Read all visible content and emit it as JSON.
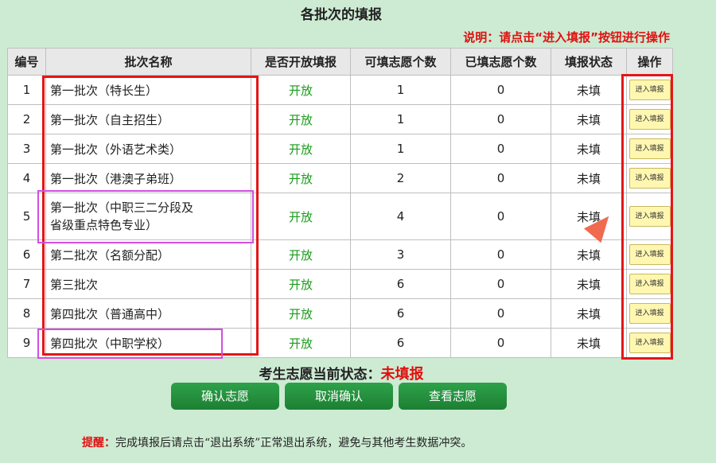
{
  "page": {
    "title": "各批次的填报",
    "note": "说明：请点击“进入填报”按钮进行操作"
  },
  "table": {
    "headers": [
      "编号",
      "批次名称",
      "是否开放填报",
      "可填志愿个数",
      "已填志愿个数",
      "填报状态",
      "操作"
    ],
    "rows": [
      {
        "no": "1",
        "name": "第一批次（特长生）",
        "open": "开放",
        "allowed": "1",
        "filled": "0",
        "status": "未填",
        "action": "进入填报"
      },
      {
        "no": "2",
        "name": "第一批次（自主招生）",
        "open": "开放",
        "allowed": "1",
        "filled": "0",
        "status": "未填",
        "action": "进入填报"
      },
      {
        "no": "3",
        "name": "第一批次（外语艺术类）",
        "open": "开放",
        "allowed": "1",
        "filled": "0",
        "status": "未填",
        "action": "进入填报"
      },
      {
        "no": "4",
        "name": "第一批次（港澳子弟班）",
        "open": "开放",
        "allowed": "2",
        "filled": "0",
        "status": "未填",
        "action": "进入填报"
      },
      {
        "no": "5",
        "name": "第一批次（中职三二分段及省级重点特色专业）",
        "open": "开放",
        "allowed": "4",
        "filled": "0",
        "status": "未填",
        "action": "进入填报"
      },
      {
        "no": "6",
        "name": "第二批次（名额分配）",
        "open": "开放",
        "allowed": "3",
        "filled": "0",
        "status": "未填",
        "action": "进入填报"
      },
      {
        "no": "7",
        "name": "第三批次",
        "open": "开放",
        "allowed": "6",
        "filled": "0",
        "status": "未填",
        "action": "进入填报"
      },
      {
        "no": "8",
        "name": "第四批次（普通高中）",
        "open": "开放",
        "allowed": "6",
        "filled": "0",
        "status": "未填",
        "action": "进入填报"
      },
      {
        "no": "9",
        "name": "第四批次（中职学校）",
        "open": "开放",
        "allowed": "6",
        "filled": "0",
        "status": "未填",
        "action": "进入填报"
      }
    ]
  },
  "status": {
    "label": "考生志愿当前状态：",
    "value": "未填报"
  },
  "buttons": {
    "confirm": "确认志愿",
    "cancel": "取消确认",
    "view": "查看志愿"
  },
  "reminder": {
    "label": "提醒：",
    "text": "完成填报后请点击“退出系统”正常退出系统，避免与其他考生数据冲突。"
  },
  "colors": {
    "background": "#cdebd3",
    "highlight_red": "#e31616",
    "highlight_purple": "#d44ee0",
    "open_green": "#1a9a1a",
    "button_green": "#2ea24a"
  }
}
